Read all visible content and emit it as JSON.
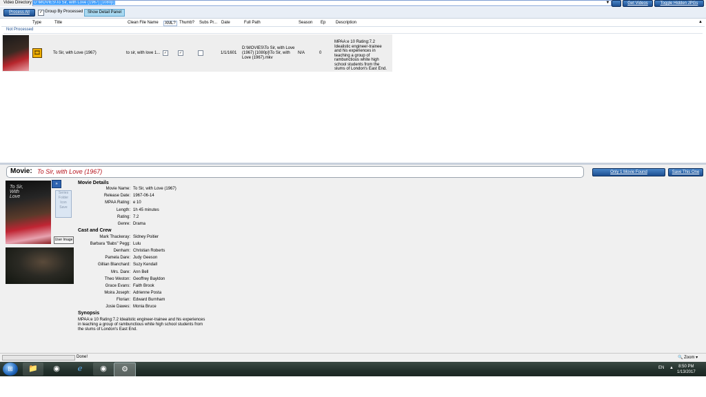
{
  "topbar": {
    "dir_label": "Video Directory",
    "dir_value": "D:\\MOVIES\\To Sir, with Love (1967) [1080p]",
    "get_videos": "Get Videos",
    "toggle_hidden": "Toggle Hidden JPGs"
  },
  "toolbar": {
    "process_all": "Process All",
    "group_checked": "✓",
    "group_label": "Group By Processed",
    "detail_panel": "Show Detail Panel"
  },
  "grid": {
    "headers": [
      "Type",
      "Title",
      "Clean File Name",
      "XML?",
      "Thumb?",
      "Subs Pr...",
      "Date",
      "Full Path",
      "Season",
      "Ep",
      "Description"
    ],
    "group": "Not Processed",
    "row": {
      "title": "To Sir, with Love (1967)",
      "clean": "to sir, with love  1...",
      "xml": "✓",
      "thumb": "✓",
      "subs": "",
      "date": "1/1/1601",
      "fullpath": "D:\\MOVIES\\To Sir, with Love (1967) [1080p]\\To Sir, with Love (1967).mkv",
      "season": "N/A",
      "ep": "0",
      "description": "MPAA:e 10 Rating:7.2 Idealistic engineer-trainee and his experiences in teaching a group of rambunctious white high school students from the slums of London's East End."
    }
  },
  "detail": {
    "movie_prefix": "Movie:",
    "movie_title": "To Sir, with Love (1967)",
    "only_one": "Only 1 Movie Found",
    "save_one": "Save This One",
    "poster_text": "To Sir, With Love",
    "series_btn": "Series Folder Icon Save",
    "user_image": "User Image",
    "movie_details_heading": "Movie Details",
    "details": [
      {
        "label": "Movie Name:",
        "value": "To Sir, with Love (1967)"
      },
      {
        "label": "Release Date:",
        "value": "1967-06-14"
      },
      {
        "label": "MPAA Rating:",
        "value": "e 10"
      },
      {
        "label": "Length:",
        "value": "1h 45 minutes"
      },
      {
        "label": "Rating:",
        "value": "7.2"
      },
      {
        "label": "Genre:",
        "value": "Drama"
      }
    ],
    "cast_heading": "Cast and Crew",
    "cast": [
      {
        "label": "Mark Thackeray:",
        "value": "Sidney Poitier"
      },
      {
        "label": "Barbara \"Babs\" Pegg:",
        "value": "Lulu"
      },
      {
        "label": "Denham:",
        "value": "Christian Roberts"
      },
      {
        "label": "Pamela Dare:",
        "value": "Judy Geeson"
      },
      {
        "label": "Gillian Blanchard:",
        "value": "Suzy Kendall"
      },
      {
        "label": "Mrs. Dare:",
        "value": "Ann Bell"
      },
      {
        "label": "Theo Weston:",
        "value": "Geoffrey Bayldon"
      },
      {
        "label": "Grace Evans:",
        "value": "Faith Brook"
      },
      {
        "label": "Moira Joseph:",
        "value": "Adrienne Posta"
      },
      {
        "label": "Florian:",
        "value": "Edward Burnham"
      },
      {
        "label": "Josie Dawes:",
        "value": "Monia Bruce"
      }
    ],
    "synopsis_heading": "Synopsis",
    "synopsis": "MPAA:e 10 Rating:7.2 Idealistic engineer-trainee and his experiences in teaching a group of rambunctious white high school students from the slums of London's East End."
  },
  "status": {
    "text": "Done!",
    "zoom": "Zoom"
  },
  "taskbar": {
    "lang": "EN",
    "time": "8:50 PM",
    "date": "1/13/2017"
  }
}
